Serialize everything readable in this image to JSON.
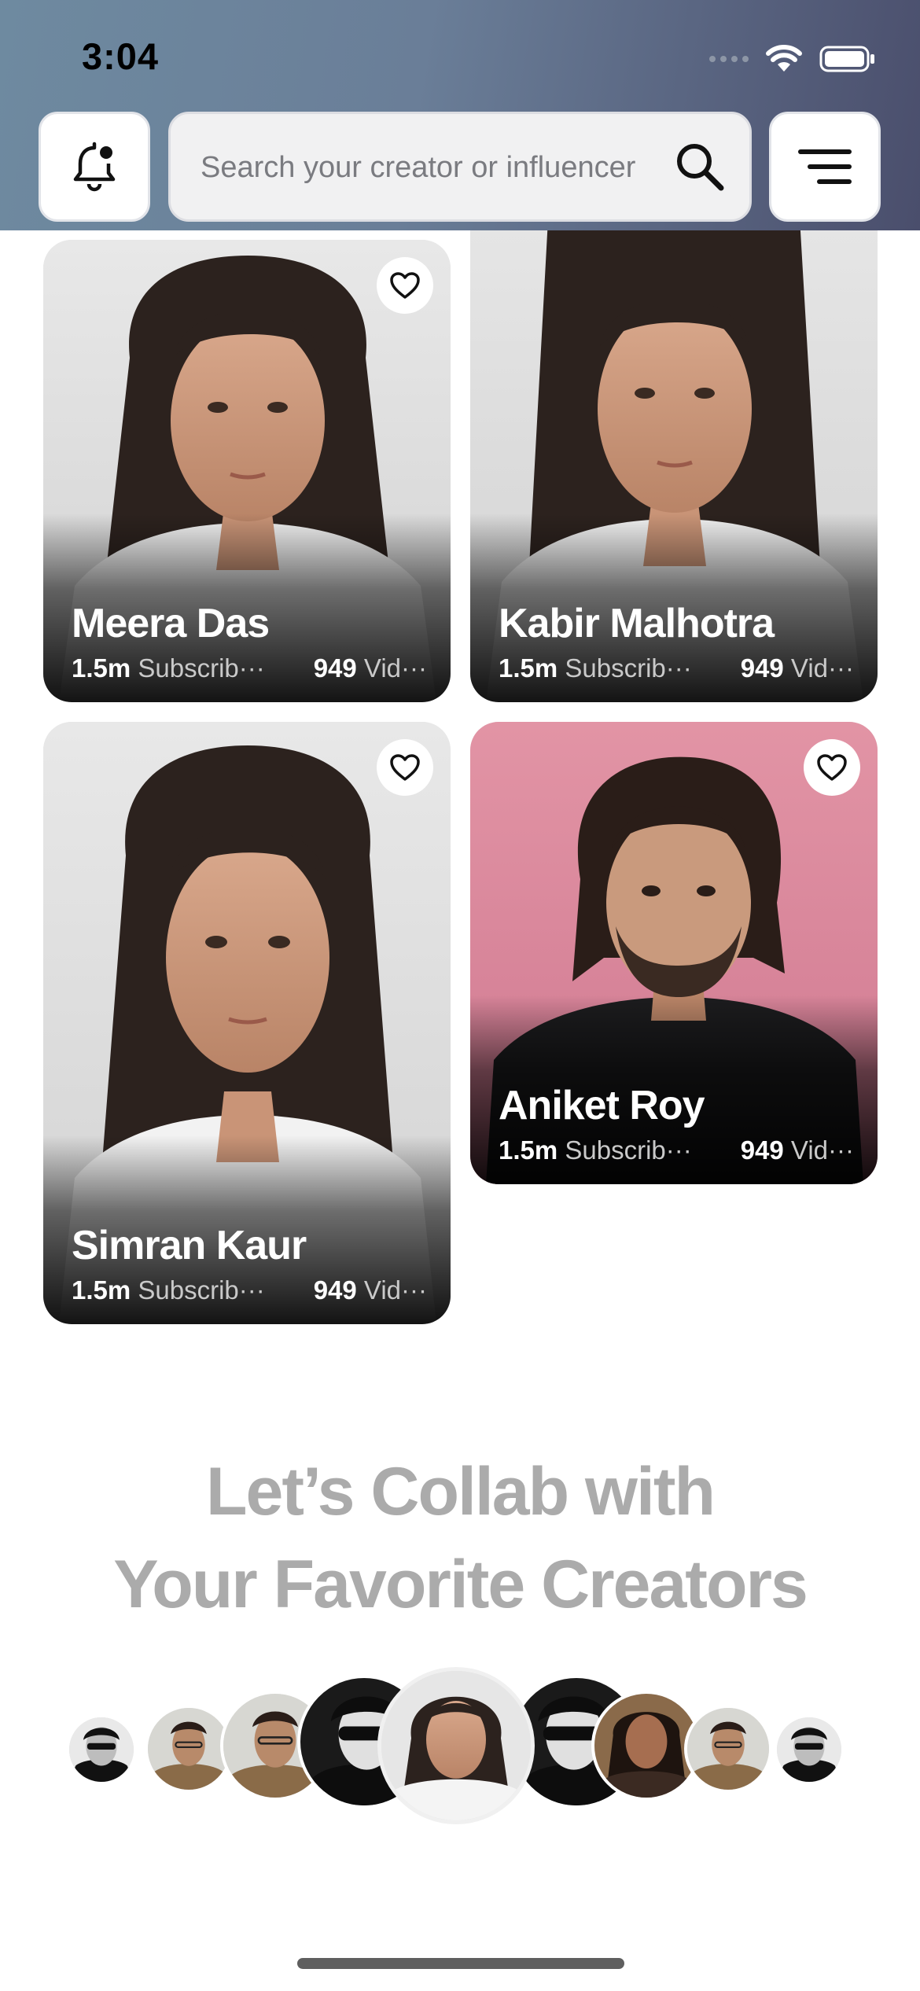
{
  "status_bar": {
    "time": "3:04"
  },
  "header": {
    "search_placeholder": "Search your creator or influencer",
    "icons": {
      "notifications": "bell-with-dot-icon",
      "search": "search-icon",
      "menu": "menu-icon"
    }
  },
  "creators": [
    {
      "name": "Meera Das",
      "subscribers_value": "1.5m",
      "subscribers_label": "Subscrib···",
      "videos_value": "949",
      "videos_label": "Vid···",
      "favorite_icon": "heart-icon"
    },
    {
      "name": "Kabir Malhotra",
      "subscribers_value": "1.5m",
      "subscribers_label": "Subscrib···",
      "videos_value": "949",
      "videos_label": "Vid···"
    },
    {
      "name": "Simran Kaur",
      "subscribers_value": "1.5m",
      "subscribers_label": "Subscrib···",
      "videos_value": "949",
      "videos_label": "Vid···",
      "favorite_icon": "heart-icon"
    },
    {
      "name": "Aniket Roy",
      "subscribers_value": "1.5m",
      "subscribers_label": "Subscrib···",
      "videos_value": "949",
      "videos_label": "Vid···",
      "favorite_icon": "heart-icon"
    }
  ],
  "collab": {
    "headline_line1": "Let’s Collab with",
    "headline_line2": "Your Favorite Creators"
  },
  "colors": {
    "header_gradient_start": "#6e8aa0",
    "header_gradient_end": "#4a4e6c",
    "headline_text": "#ababab",
    "card_overlay": "#000000"
  }
}
